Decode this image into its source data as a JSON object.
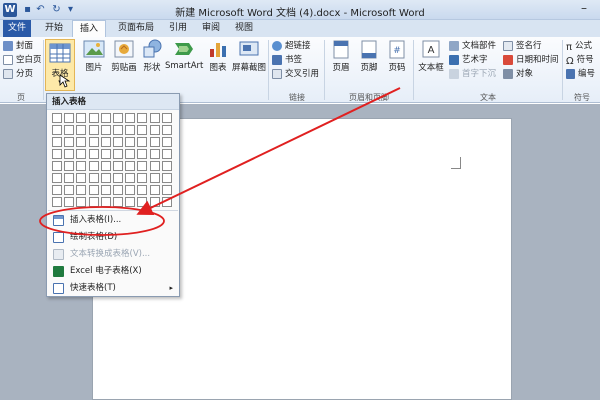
{
  "window": {
    "title": "新建 Microsoft Word 文档 (4).docx - Microsoft Word",
    "app_icon": "W",
    "quick_access": [
      "save-icon",
      "undo-icon",
      "redo-icon",
      "customize-icon"
    ],
    "minimize_glyph": "–"
  },
  "tabs": [
    "文件",
    "开始",
    "插入",
    "页面布局",
    "引用",
    "审阅",
    "视图"
  ],
  "active_tab": "插入",
  "ribbon": {
    "pages": {
      "cover": "封面",
      "blank": "空白页",
      "break": "分页",
      "label": "页"
    },
    "tables": {
      "table": "表格",
      "dropdown_arrow": "▾"
    },
    "illustrations": {
      "picture": "图片",
      "clipart": "剪贴画",
      "shapes": "形状",
      "smartart": "SmartArt",
      "chart": "图表",
      "screenshot": "屏幕截图"
    },
    "links": {
      "hyperlink": "超链接",
      "bookmark": "书签",
      "crossref": "交叉引用",
      "label": "链接"
    },
    "header_footer": {
      "header": "页眉",
      "footer": "页脚",
      "pagenum": "页码",
      "label": "页眉和页脚"
    },
    "text": {
      "textbox": "文本框",
      "quickparts": "文档部件",
      "wordart": "艺术字",
      "dropcap": "首字下沉",
      "signature": "签名行",
      "datetime": "日期和时间",
      "object": "对象",
      "label": "文本"
    },
    "symbols": {
      "equation": "公式",
      "symbol": "符号",
      "number": "编号",
      "label": "符号"
    }
  },
  "dropdown": {
    "header": "插入表格",
    "grid": {
      "cols": 10,
      "rows": 8
    },
    "items": [
      {
        "label": "插入表格(I)...",
        "disabled": false
      },
      {
        "label": "绘制表格(D)",
        "disabled": false
      },
      {
        "label": "文本转换成表格(V)...",
        "disabled": true
      },
      {
        "label": "Excel 电子表格(X)",
        "disabled": false
      },
      {
        "label": "快速表格(T)",
        "disabled": false,
        "submenu": "▸"
      }
    ]
  },
  "annotation": {
    "color": "#e02020"
  },
  "colors": {
    "ribbon_blue": "#2b579a",
    "file_tab": "#2a5aa8",
    "highlight": "#fde9a8"
  }
}
